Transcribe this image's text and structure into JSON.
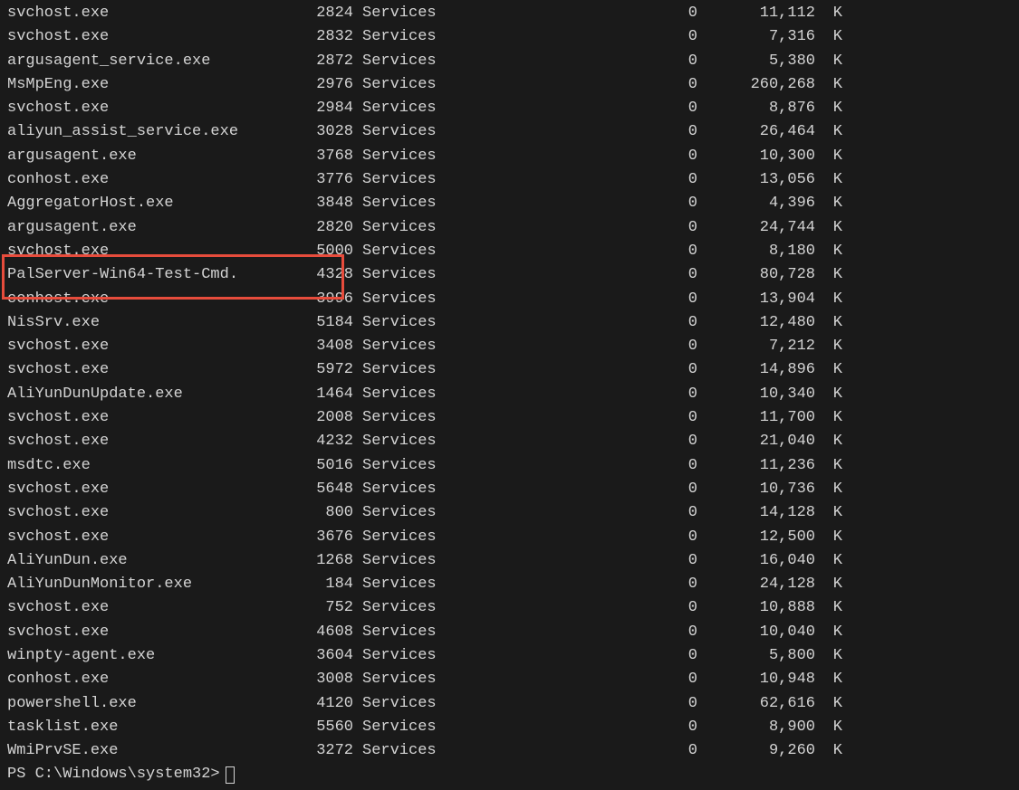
{
  "processes": [
    {
      "name": "svchost.exe",
      "pid": "2824",
      "session": "Services",
      "sessnum": "0",
      "mem": "11,112",
      "unit": "K"
    },
    {
      "name": "svchost.exe",
      "pid": "2832",
      "session": "Services",
      "sessnum": "0",
      "mem": "7,316",
      "unit": "K"
    },
    {
      "name": "argusagent_service.exe",
      "pid": "2872",
      "session": "Services",
      "sessnum": "0",
      "mem": "5,380",
      "unit": "K"
    },
    {
      "name": "MsMpEng.exe",
      "pid": "2976",
      "session": "Services",
      "sessnum": "0",
      "mem": "260,268",
      "unit": "K"
    },
    {
      "name": "svchost.exe",
      "pid": "2984",
      "session": "Services",
      "sessnum": "0",
      "mem": "8,876",
      "unit": "K"
    },
    {
      "name": "aliyun_assist_service.exe",
      "pid": "3028",
      "session": "Services",
      "sessnum": "0",
      "mem": "26,464",
      "unit": "K"
    },
    {
      "name": "argusagent.exe",
      "pid": "3768",
      "session": "Services",
      "sessnum": "0",
      "mem": "10,300",
      "unit": "K"
    },
    {
      "name": "conhost.exe",
      "pid": "3776",
      "session": "Services",
      "sessnum": "0",
      "mem": "13,056",
      "unit": "K"
    },
    {
      "name": "AggregatorHost.exe",
      "pid": "3848",
      "session": "Services",
      "sessnum": "0",
      "mem": "4,396",
      "unit": "K"
    },
    {
      "name": "argusagent.exe",
      "pid": "2820",
      "session": "Services",
      "sessnum": "0",
      "mem": "24,744",
      "unit": "K"
    },
    {
      "name": "svchost.exe",
      "pid": "5000",
      "session": "Services",
      "sessnum": "0",
      "mem": "8,180",
      "unit": "K"
    },
    {
      "name": "PalServer-Win64-Test-Cmd.",
      "pid": "4328",
      "session": "Services",
      "sessnum": "0",
      "mem": "80,728",
      "unit": "K"
    },
    {
      "name": "conhost.exe",
      "pid": "3996",
      "session": "Services",
      "sessnum": "0",
      "mem": "13,904",
      "unit": "K"
    },
    {
      "name": "NisSrv.exe",
      "pid": "5184",
      "session": "Services",
      "sessnum": "0",
      "mem": "12,480",
      "unit": "K"
    },
    {
      "name": "svchost.exe",
      "pid": "3408",
      "session": "Services",
      "sessnum": "0",
      "mem": "7,212",
      "unit": "K"
    },
    {
      "name": "svchost.exe",
      "pid": "5972",
      "session": "Services",
      "sessnum": "0",
      "mem": "14,896",
      "unit": "K"
    },
    {
      "name": "AliYunDunUpdate.exe",
      "pid": "1464",
      "session": "Services",
      "sessnum": "0",
      "mem": "10,340",
      "unit": "K"
    },
    {
      "name": "svchost.exe",
      "pid": "2008",
      "session": "Services",
      "sessnum": "0",
      "mem": "11,700",
      "unit": "K"
    },
    {
      "name": "svchost.exe",
      "pid": "4232",
      "session": "Services",
      "sessnum": "0",
      "mem": "21,040",
      "unit": "K"
    },
    {
      "name": "msdtc.exe",
      "pid": "5016",
      "session": "Services",
      "sessnum": "0",
      "mem": "11,236",
      "unit": "K"
    },
    {
      "name": "svchost.exe",
      "pid": "5648",
      "session": "Services",
      "sessnum": "0",
      "mem": "10,736",
      "unit": "K"
    },
    {
      "name": "svchost.exe",
      "pid": "800",
      "session": "Services",
      "sessnum": "0",
      "mem": "14,128",
      "unit": "K"
    },
    {
      "name": "svchost.exe",
      "pid": "3676",
      "session": "Services",
      "sessnum": "0",
      "mem": "12,500",
      "unit": "K"
    },
    {
      "name": "AliYunDun.exe",
      "pid": "1268",
      "session": "Services",
      "sessnum": "0",
      "mem": "16,040",
      "unit": "K"
    },
    {
      "name": "AliYunDunMonitor.exe",
      "pid": "184",
      "session": "Services",
      "sessnum": "0",
      "mem": "24,128",
      "unit": "K"
    },
    {
      "name": "svchost.exe",
      "pid": "752",
      "session": "Services",
      "sessnum": "0",
      "mem": "10,888",
      "unit": "K"
    },
    {
      "name": "svchost.exe",
      "pid": "4608",
      "session": "Services",
      "sessnum": "0",
      "mem": "10,040",
      "unit": "K"
    },
    {
      "name": "winpty-agent.exe",
      "pid": "3604",
      "session": "Services",
      "sessnum": "0",
      "mem": "5,800",
      "unit": "K"
    },
    {
      "name": "conhost.exe",
      "pid": "3008",
      "session": "Services",
      "sessnum": "0",
      "mem": "10,948",
      "unit": "K"
    },
    {
      "name": "powershell.exe",
      "pid": "4120",
      "session": "Services",
      "sessnum": "0",
      "mem": "62,616",
      "unit": "K"
    },
    {
      "name": "tasklist.exe",
      "pid": "5560",
      "session": "Services",
      "sessnum": "0",
      "mem": "8,900",
      "unit": "K"
    },
    {
      "name": "WmiPrvSE.exe",
      "pid": "3272",
      "session": "Services",
      "sessnum": "0",
      "mem": "9,260",
      "unit": "K"
    }
  ],
  "prompt": "PS C:\\Windows\\system32>"
}
